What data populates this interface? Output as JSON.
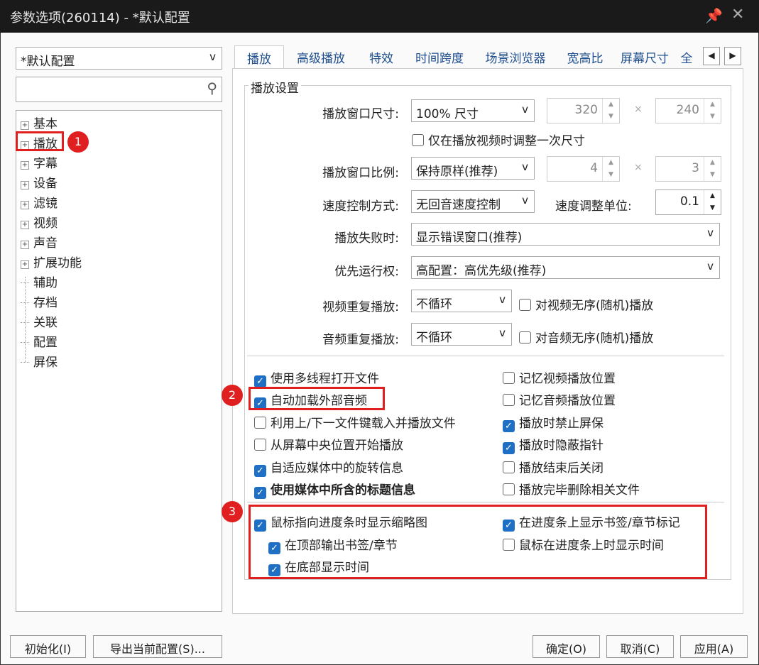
{
  "title": "参数选项(260114) - *默认配置",
  "profile": "*默认配置",
  "search_placeholder": "",
  "tree": [
    {
      "label": "基本",
      "expandable": true
    },
    {
      "label": "播放",
      "expandable": true
    },
    {
      "label": "字幕",
      "expandable": true
    },
    {
      "label": "设备",
      "expandable": true
    },
    {
      "label": "滤镜",
      "expandable": true
    },
    {
      "label": "视频",
      "expandable": true
    },
    {
      "label": "声音",
      "expandable": true
    },
    {
      "label": "扩展功能",
      "expandable": true
    },
    {
      "label": "辅助",
      "expandable": false
    },
    {
      "label": "存档",
      "expandable": false
    },
    {
      "label": "关联",
      "expandable": false
    },
    {
      "label": "配置",
      "expandable": false
    },
    {
      "label": "屏保",
      "expandable": false
    }
  ],
  "tabs": [
    "播放",
    "高级播放",
    "特效",
    "时间跨度",
    "场景浏览器",
    "宽高比",
    "屏幕尺寸",
    "全"
  ],
  "group_title": "播放设置",
  "form": {
    "win_size_label": "播放窗口尺寸:",
    "win_size": "100% 尺寸",
    "width": "320",
    "height": "240",
    "times": "×",
    "resize_once": "仅在播放视频时调整一次尺寸",
    "ratio_label": "播放窗口比例:",
    "ratio": "保持原样(推荐)",
    "ratio_w": "4",
    "ratio_h": "3",
    "speed_label": "速度控制方式:",
    "speed": "无回音速度控制",
    "speed_unit_label": "速度调整单位:",
    "speed_unit": "0.1",
    "fail_label": "播放失败时:",
    "fail": "显示错误窗口(推荐)",
    "priority_label": "优先运行权:",
    "priority": "高配置：高优先级(推荐)",
    "video_repeat_label": "视频重复播放:",
    "video_repeat": "不循环",
    "video_shuffle": "对视频无序(随机)播放",
    "audio_repeat_label": "音频重复播放:",
    "audio_repeat": "不循环",
    "audio_shuffle": "对音频无序(随机)播放"
  },
  "checks": [
    {
      "label": "使用多线程打开文件",
      "checked": true,
      "col": 0,
      "row": 0
    },
    {
      "label": "记忆视频播放位置",
      "checked": false,
      "col": 1,
      "row": 0
    },
    {
      "label": "自动加载外部音频",
      "checked": true,
      "col": 0,
      "row": 1
    },
    {
      "label": "记忆音频播放位置",
      "checked": false,
      "col": 1,
      "row": 1
    },
    {
      "label": "利用上/下一文件键载入并播放文件",
      "checked": false,
      "col": 0,
      "row": 2
    },
    {
      "label": "播放时禁止屏保",
      "checked": true,
      "col": 1,
      "row": 2
    },
    {
      "label": "从屏幕中央位置开始播放",
      "checked": false,
      "col": 0,
      "row": 3
    },
    {
      "label": "播放时隐蔽指针",
      "checked": true,
      "col": 1,
      "row": 3
    },
    {
      "label": "自适应媒体中的旋转信息",
      "checked": true,
      "col": 0,
      "row": 4
    },
    {
      "label": "播放结束后关闭",
      "checked": false,
      "col": 1,
      "row": 4
    },
    {
      "label": "使用媒体中所含的标题信息",
      "checked": true,
      "col": 0,
      "row": 5,
      "bold": true
    },
    {
      "label": "播放完毕删除相关文件",
      "checked": false,
      "col": 1,
      "row": 5
    }
  ],
  "checks2": [
    {
      "label": "鼠标指向进度条时显示缩略图",
      "checked": true,
      "col": 0,
      "row": 0
    },
    {
      "label": "在进度条上显示书签/章节标记",
      "checked": true,
      "col": 1,
      "row": 0
    },
    {
      "label": "在顶部输出书签/章节",
      "checked": true,
      "col": 0,
      "row": 1,
      "indent": true
    },
    {
      "label": "鼠标在进度条上时显示时间",
      "checked": false,
      "col": 1,
      "row": 1
    },
    {
      "label": "在底部显示时间",
      "checked": true,
      "col": 0,
      "row": 2,
      "indent": true
    }
  ],
  "annotations": [
    "1",
    "2",
    "3"
  ],
  "buttons": {
    "init": "初始化(I)",
    "export": "导出当前配置(S)...",
    "ok": "确定(O)",
    "cancel": "取消(C)",
    "apply": "应用(A)"
  },
  "colors": {
    "accent": "#1f6fc5",
    "annotation": "#e02020"
  }
}
